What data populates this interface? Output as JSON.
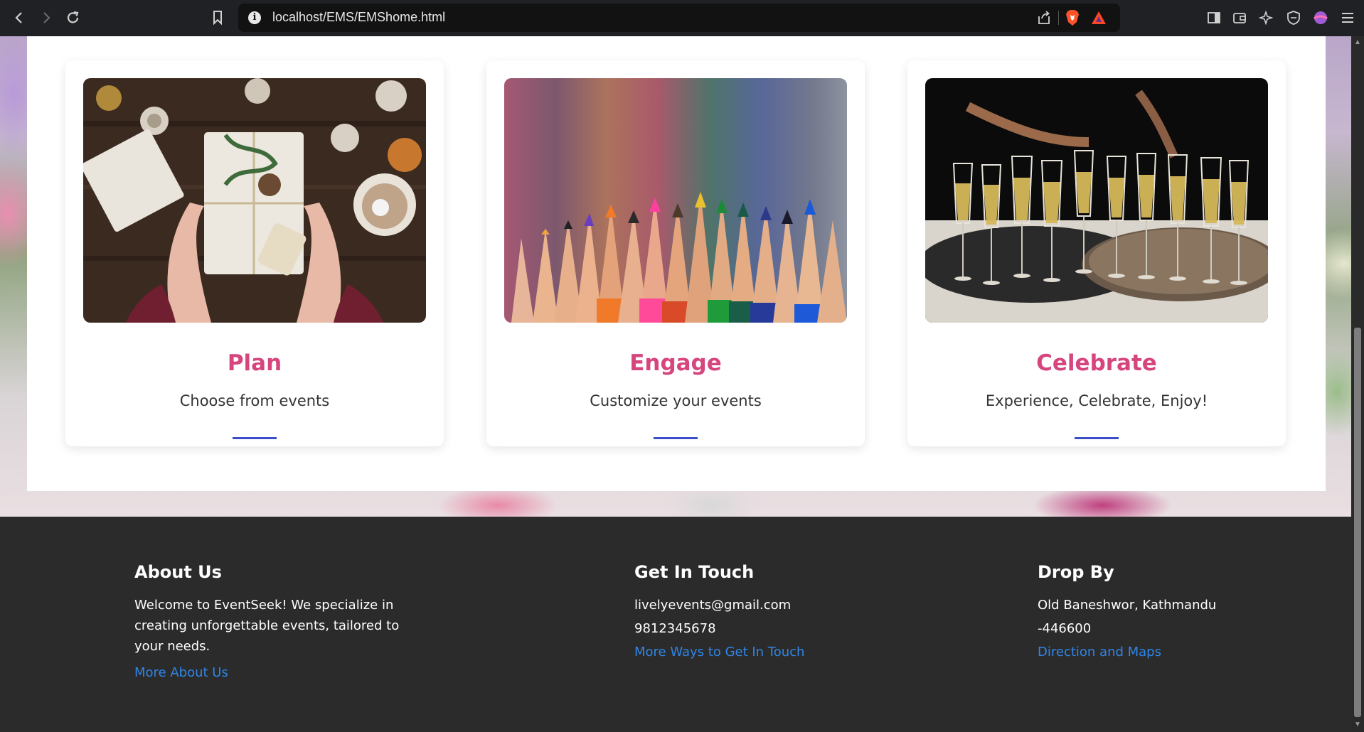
{
  "browser": {
    "url": "localhost/EMS/EMShome.html"
  },
  "cards": [
    {
      "title": "Plan",
      "subtitle": "Choose from events",
      "image": "gift-boxes-photo"
    },
    {
      "title": "Engage",
      "subtitle": "Customize your events",
      "image": "colored-pencils-photo"
    },
    {
      "title": "Celebrate",
      "subtitle": "Experience, Celebrate, Enjoy!",
      "image": "champagne-glasses-photo"
    }
  ],
  "footer": {
    "about": {
      "heading": "About Us",
      "text": "Welcome to EventSeek! We specialize in creating unforgettable events, tailored to your needs.",
      "link": "More About Us"
    },
    "contact": {
      "heading": "Get In Touch",
      "email": "livelyevents@gmail.com",
      "phone": "9812345678",
      "link": "More Ways to Get In Touch"
    },
    "location": {
      "heading": "Drop By",
      "line1": "Old Baneshwor, Kathmandu",
      "line2": "-446600",
      "link": "Direction and Maps"
    }
  },
  "colors": {
    "title_pink": "#d6457e",
    "accent_blue": "#3a4fc7",
    "link_blue": "#2f86e8",
    "footer_bg": "#2b2b2b"
  }
}
